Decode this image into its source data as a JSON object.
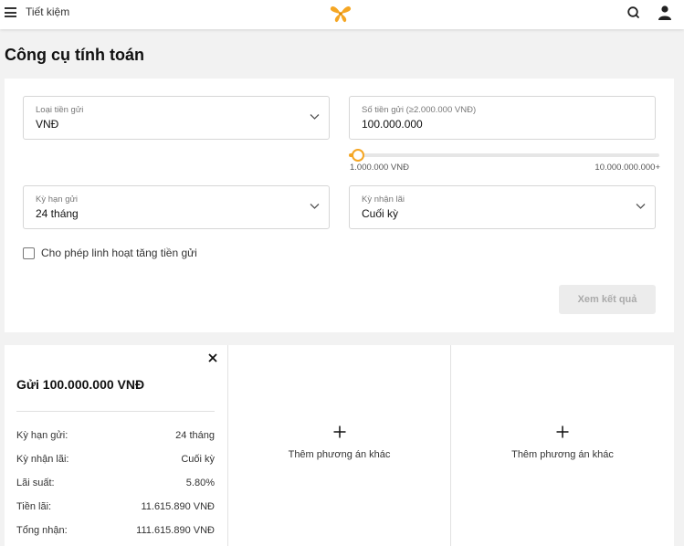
{
  "header": {
    "brand": "Tiết kiệm",
    "colors": {
      "logo": "#f5a623"
    }
  },
  "page": {
    "title": "Công cụ tính toán"
  },
  "form": {
    "currency": {
      "label": "Loại tiền gửi",
      "value": "VNĐ"
    },
    "amount": {
      "label": "Số tiền gửi (≥2.000.000 VNĐ)",
      "value": "100.000.000"
    },
    "slider": {
      "min_label": "1.000.000 VNĐ",
      "max_label": "10.000.000.000+",
      "fraction": 0.03
    },
    "term": {
      "label": "Kỳ hạn gửi",
      "value": "24 tháng"
    },
    "payout": {
      "label": "Kỳ nhận lãi",
      "value": "Cuối kỳ"
    },
    "flexible_checkbox": {
      "label": "Cho phép linh hoạt tăng tiền gửi",
      "checked": false
    },
    "submit_label": "Xem kết quả"
  },
  "results": {
    "summary": {
      "title": "Gửi 100.000.000 VNĐ",
      "rows": [
        {
          "key": "Kỳ hạn gửi:",
          "value": "24 tháng"
        },
        {
          "key": "Kỳ nhận lãi:",
          "value": "Cuối kỳ"
        },
        {
          "key": "Lãi suất:",
          "value": "5.80%"
        },
        {
          "key": "Tiền lãi:",
          "value": "11.615.890 VNĐ"
        },
        {
          "key": "Tổng nhận:",
          "value": "111.615.890 VNĐ"
        }
      ]
    },
    "add_option_label_1": "Thêm phương án khác",
    "add_option_label_2": "Thêm phương án khác"
  }
}
